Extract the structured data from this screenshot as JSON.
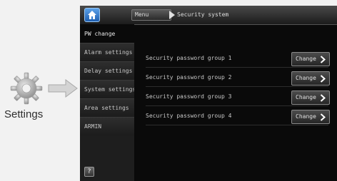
{
  "left_panel": {
    "label": "Settings",
    "gear_icon": "gear-icon",
    "arrow_icon": "arrow-right-icon"
  },
  "topbar": {
    "home_icon": "home-icon",
    "menu_label": "Menu",
    "current": "Security system"
  },
  "sidebar": {
    "items": [
      {
        "label": "PW change",
        "active": true
      },
      {
        "label": "Alarm settings",
        "active": false
      },
      {
        "label": "Delay settings",
        "active": false
      },
      {
        "label": "System settings",
        "active": false
      },
      {
        "label": "Area settings",
        "active": false
      },
      {
        "label": "ARMIN",
        "active": false
      }
    ],
    "help_label": "?"
  },
  "rows": [
    {
      "label": "Security password group 1",
      "button": "Change"
    },
    {
      "label": "Security password group 2",
      "button": "Change"
    },
    {
      "label": "Security password group 3",
      "button": "Change"
    },
    {
      "label": "Security password group 4",
      "button": "Change"
    }
  ],
  "colors": {
    "accent": "#2f7bd0",
    "screen_bg": "#0a0a0a",
    "page_bg": "#f2f2f2"
  }
}
